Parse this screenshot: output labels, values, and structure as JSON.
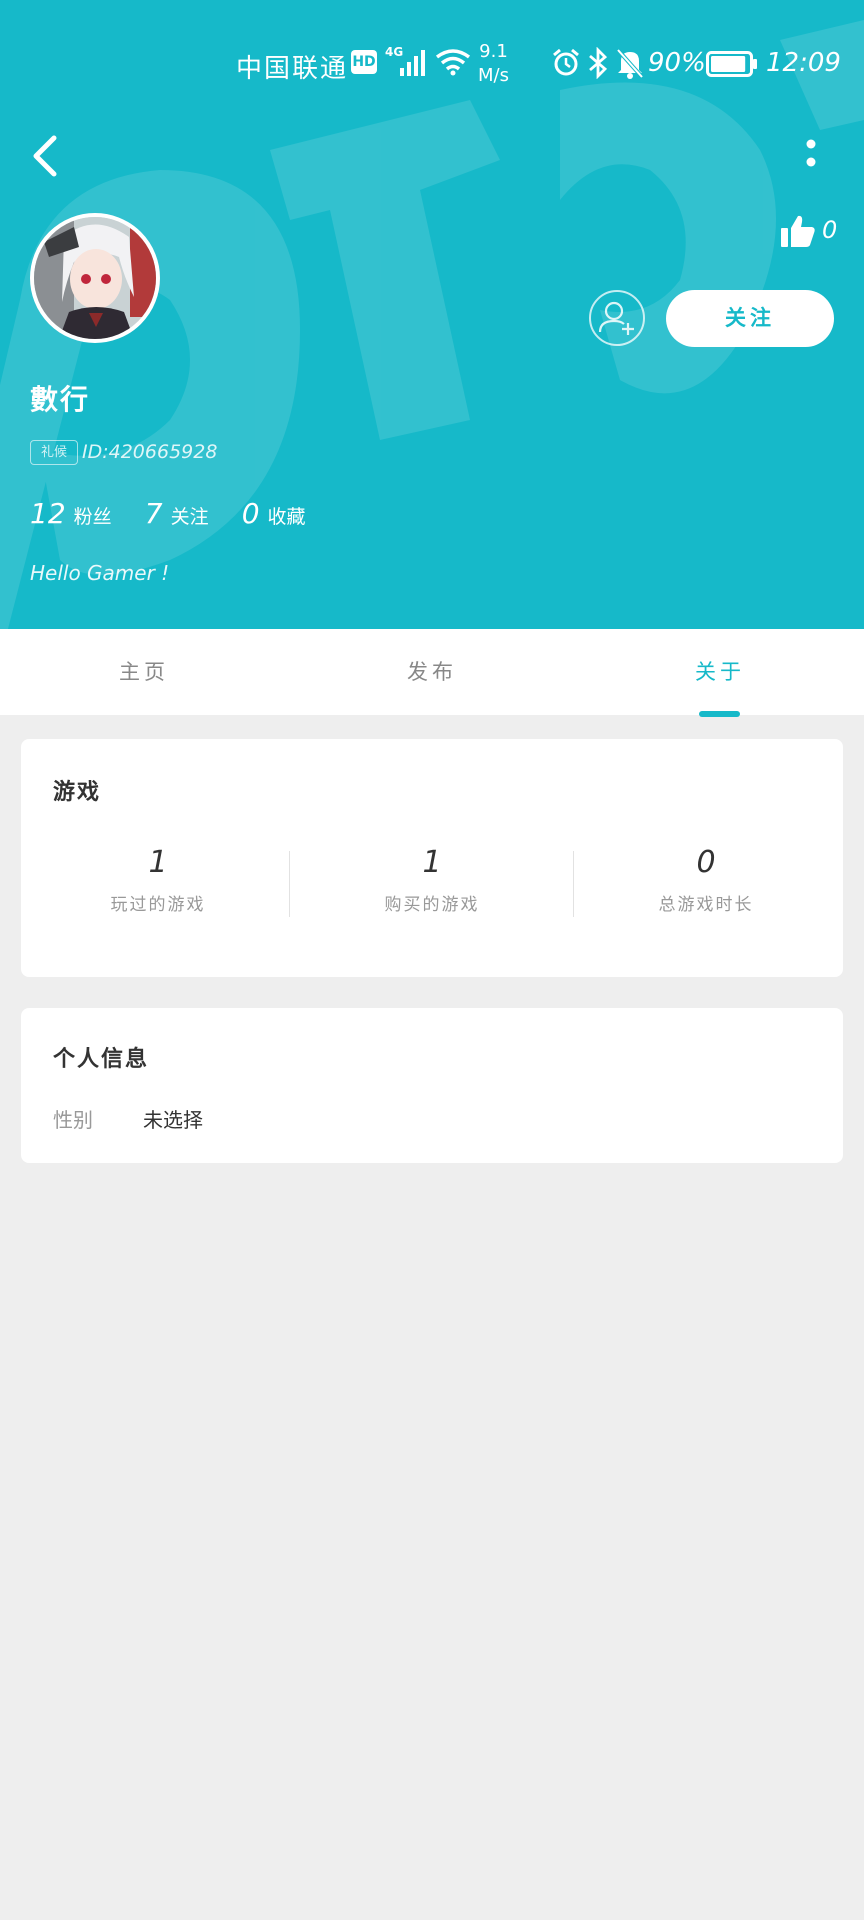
{
  "status_bar": {
    "carrier": "中国联通",
    "hd": "HD",
    "network": "4G",
    "speed_value": "9.1",
    "speed_unit": "M/s",
    "battery_percent": "90%",
    "time": "12:09",
    "battery_level": 0.9
  },
  "profile": {
    "username": "數行",
    "badge": "礼候",
    "id_text": "ID:420665928",
    "likes": "0",
    "follow_label": "关注",
    "bio": "Hello Gamer !",
    "stats": [
      {
        "num": "12",
        "label": "粉丝"
      },
      {
        "num": "7",
        "label": "关注"
      },
      {
        "num": "0",
        "label": "收藏"
      }
    ]
  },
  "tabs": [
    {
      "label": "主页",
      "active": false
    },
    {
      "label": "发布",
      "active": false
    },
    {
      "label": "关于",
      "active": true
    }
  ],
  "games_card": {
    "title": "游戏",
    "stats": [
      {
        "num": "1",
        "label": "玩过的游戏"
      },
      {
        "num": "1",
        "label": "购买的游戏"
      },
      {
        "num": "0",
        "label": "总游戏时长"
      }
    ]
  },
  "info_card": {
    "title": "个人信息",
    "gender_label": "性别",
    "gender_value": "未选择"
  },
  "colors": {
    "accent": "#16b9c9",
    "background": "#eeeeee",
    "card": "#ffffff"
  },
  "icons": [
    "back-arrow-icon",
    "more-vertical-icon",
    "thumbs-up-icon",
    "add-friend-icon",
    "signal-icon",
    "wifi-icon",
    "alarm-icon",
    "bluetooth-icon",
    "mute-icon",
    "battery-icon"
  ]
}
